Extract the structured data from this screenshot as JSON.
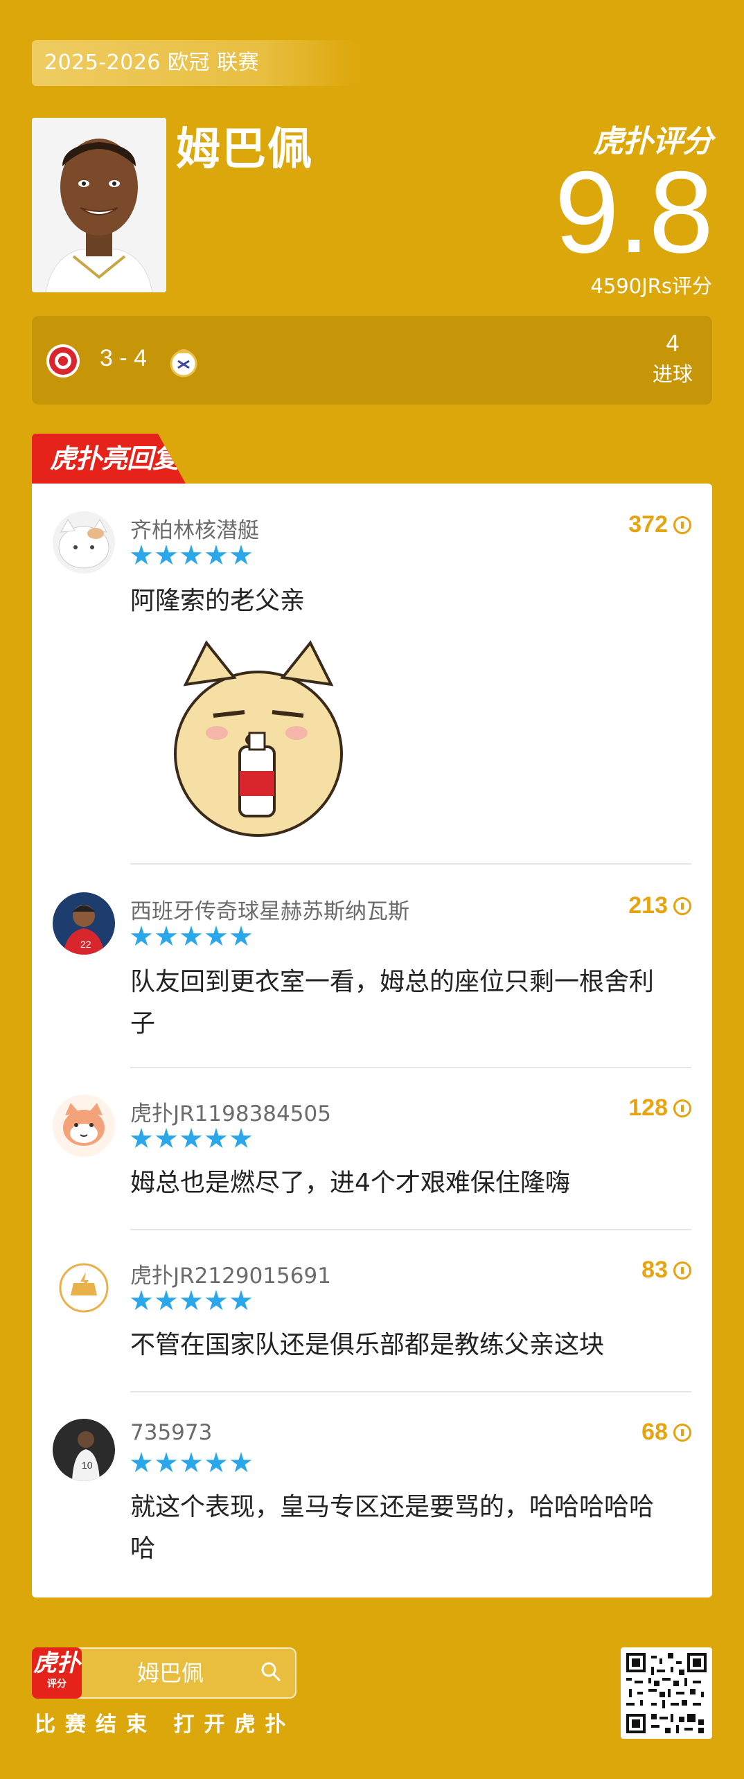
{
  "header": {
    "league": "2025-2026 欧冠 联赛",
    "player_name": "姆巴佩",
    "brand": "虎扑评分",
    "rating": "9.8",
    "rating_count": "4590JRs评分"
  },
  "match": {
    "score": "3 - 4",
    "stat_value": "4",
    "stat_label": "进球",
    "colors": {
      "home": "#D8262C",
      "away": "#E9C24B"
    }
  },
  "hot_tag": "虎扑亮回复",
  "comments": [
    {
      "username": "齐柏林核潜艇",
      "likes": "372",
      "stars": 5,
      "text": "阿隆索的老父亲",
      "has_sticker": true
    },
    {
      "username": "西班牙传奇球星赫苏斯纳瓦斯",
      "likes": "213",
      "stars": 5,
      "text": "队友回到更衣室一看，姆总的座位只剩一根舍利子"
    },
    {
      "username": "虎扑JR1198384505",
      "likes": "128",
      "stars": 5,
      "text": "姆总也是燃尽了，进4个才艰难保住隆嗨"
    },
    {
      "username": "虎扑JR2129015691",
      "likes": "83",
      "stars": 5,
      "text": "不管在国家队还是俱乐部都是教练父亲这块"
    },
    {
      "username": "735973",
      "likes": "68",
      "stars": 5,
      "text": "就这个表现，皇马专区还是要骂的，哈哈哈哈哈哈"
    }
  ],
  "footer": {
    "app_icon_main": "虎扑",
    "app_icon_sub": "评分",
    "search_text": "姆巴佩",
    "cta": "比赛结束 打开虎扑"
  },
  "colors": {
    "background": "#DCA70A",
    "accent_red": "#E5231A",
    "star_blue": "#2AA7EA",
    "likes_gold": "#E5A410"
  }
}
